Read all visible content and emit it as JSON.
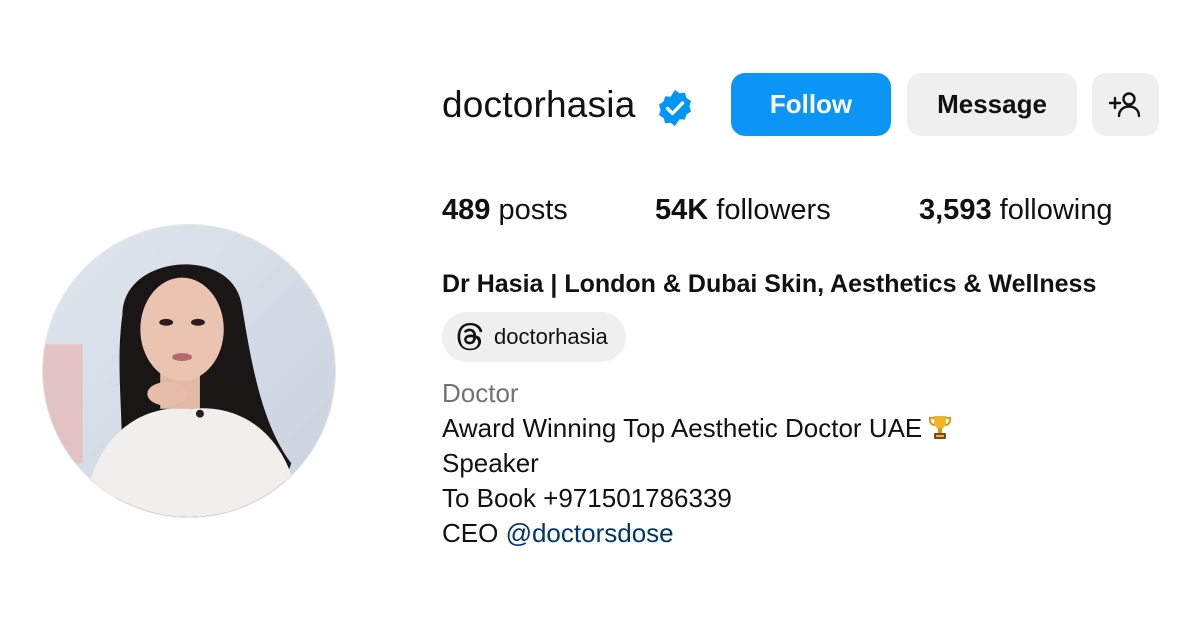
{
  "profile": {
    "username": "doctorhasia",
    "verified": true,
    "avatar_alt": "profile picture",
    "full_name": "Dr Hasia | London & Dubai Skin, Aesthetics & Wellness"
  },
  "actions": {
    "follow_label": "Follow",
    "message_label": "Message",
    "add_user_icon": "add-user-icon"
  },
  "stats": {
    "posts_count": "489",
    "posts_label": " posts",
    "followers_count": "54K",
    "followers_label": " followers",
    "following_count": "3,593",
    "following_label": " following"
  },
  "threads": {
    "icon": "threads-icon",
    "handle": "doctorhasia"
  },
  "bio": {
    "category": "Doctor",
    "line1": "Award Winning Top Aesthetic Doctor UAE",
    "line1_emoji": "trophy-icon",
    "line2": "Speaker",
    "line3": "To Book +971501786339",
    "line4_prefix": "CEO ",
    "line4_mention": "@doctorsdose"
  },
  "colors": {
    "follow_button": "#0b95f6",
    "secondary_button": "#efefef",
    "verified_badge": "#0095f6",
    "category_text": "#737373",
    "mention_link": "#00376b"
  }
}
